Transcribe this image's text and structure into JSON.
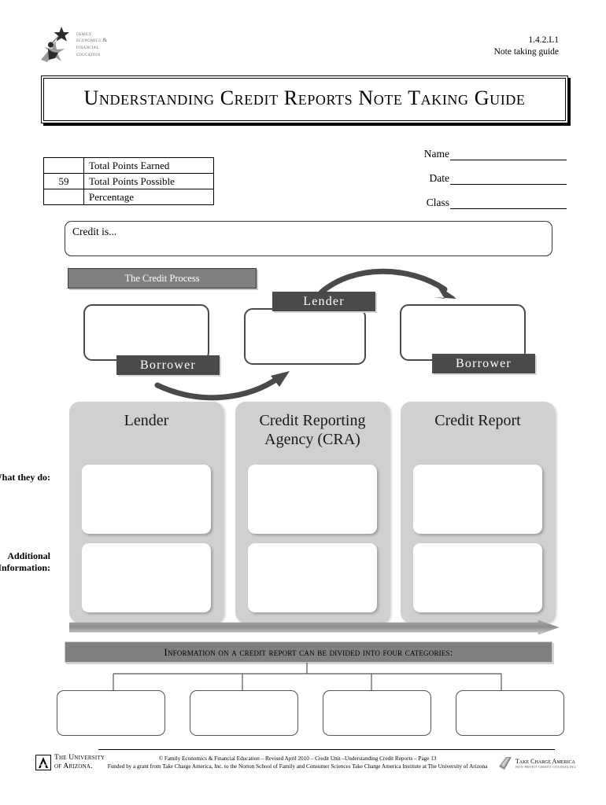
{
  "header": {
    "logo_lines": [
      "Family",
      "Economics &",
      "Financial",
      "Education"
    ],
    "logo_icon": "star-person-logo",
    "doc_code": "1.4.2.L1",
    "doc_type": "Note taking guide"
  },
  "title": {
    "text": "Understanding Credit Reports Note Taking Guide"
  },
  "points_table": {
    "rows": [
      {
        "value": "",
        "label": "Total Points Earned"
      },
      {
        "value": "59",
        "label": "Total Points Possible"
      },
      {
        "value": "",
        "label": "Percentage"
      }
    ]
  },
  "student_fields": [
    {
      "label": "Name",
      "value": ""
    },
    {
      "label": "Date",
      "value": ""
    },
    {
      "label": "Class",
      "value": ""
    }
  ],
  "credit_is": {
    "prompt": "Credit is...",
    "value": ""
  },
  "credit_process": {
    "banner": "The Credit Process",
    "nodes": [
      {
        "tag": "Borrower"
      },
      {
        "tag": "Lender"
      },
      {
        "tag": "Borrower"
      }
    ]
  },
  "columns": [
    {
      "title": "Lender",
      "what_they_do": "",
      "additional_information": ""
    },
    {
      "title": "Credit Reporting Agency (CRA)",
      "what_they_do": "",
      "additional_information": ""
    },
    {
      "title": "Credit Report",
      "what_they_do": "",
      "additional_information": ""
    }
  ],
  "row_labels": [
    "What they do:",
    "Additional Information:"
  ],
  "info_banner": {
    "text": "Information on a credit report can be divided into four categories:"
  },
  "categories": [
    {
      "value": ""
    },
    {
      "value": ""
    },
    {
      "value": ""
    },
    {
      "value": ""
    }
  ],
  "footer": {
    "university_lines": [
      "The University",
      "of Arizona."
    ],
    "university_icon": "arizona-a-logo",
    "copyright": "© Family Economics & Financial Education – Revised April 2010 – Credit Unit –Understanding Credit Reports – Page 13",
    "funding": "Funded by a grant from Take Charge America, Inc. to the Norton School of Family and Consumer Sciences Take Charge America Institute at The University of Arizona",
    "sponsor_name": "Take Charge America",
    "sponsor_tagline": "NON-PROFIT CREDIT COUNSELING",
    "sponsor_icon": "take-charge-america-logo"
  },
  "colors": {
    "banner_gray": "#808080",
    "tag_dark": "#4a4a4a",
    "column_gray": "#d0d0d0"
  }
}
